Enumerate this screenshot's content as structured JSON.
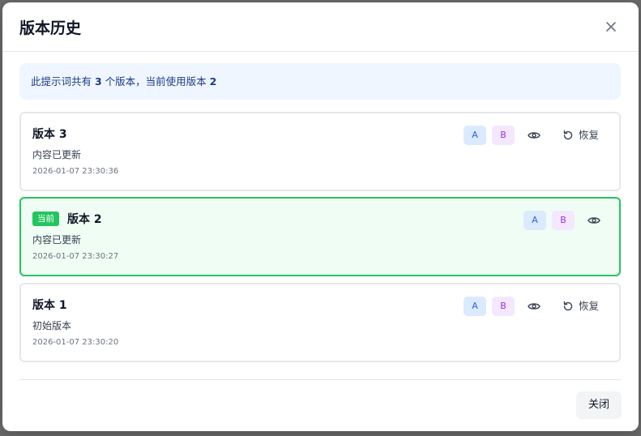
{
  "dialog": {
    "title": "版本历史",
    "close_label": "关闭"
  },
  "info": {
    "prefix": "此提示词共有 ",
    "count": "3",
    "middle": " 个版本，当前使用版本 ",
    "current": "2"
  },
  "versions": [
    {
      "name": "版本 3",
      "description": "内容已更新",
      "timestamp": "2026-01-07 23:30:36",
      "current": false,
      "restore_label": "恢复"
    },
    {
      "name": "版本 2",
      "description": "内容已更新",
      "timestamp": "2026-01-07 23:30:27",
      "current": true,
      "current_badge": "当前"
    },
    {
      "name": "版本 1",
      "description": "初始版本",
      "timestamp": "2026-01-07 23:30:20",
      "current": false,
      "restore_label": "恢复"
    }
  ],
  "compare": {
    "a_label": "A",
    "b_label": "B"
  },
  "colors": {
    "current_border": "#22c55e",
    "current_bg": "#f0fdf4",
    "info_bg": "#eff6ff",
    "pill_a": "#dbeafe",
    "pill_b": "#f3e8ff"
  },
  "icons": {
    "close": "close-icon",
    "view": "eye-icon",
    "restore": "restore-icon"
  }
}
